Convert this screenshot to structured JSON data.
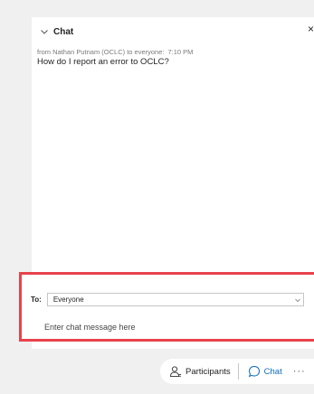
{
  "chat_panel": {
    "title": "Chat",
    "close_symbol": "×"
  },
  "message": {
    "sender_line": "from Nathan Putnam (OCLC) to everyone:",
    "time": "7:10 PM",
    "text": "How do I report an error to OCLC?"
  },
  "compose": {
    "to_label": "To:",
    "recipient": "Everyone",
    "placeholder": "Enter chat message here"
  },
  "toolbar": {
    "participants_label": "Participants",
    "chat_label": "Chat",
    "more_label": "···"
  },
  "colors": {
    "highlight_border": "#e8424c",
    "chat_accent": "#0f6cbd",
    "panel_bg": "#ffffff",
    "app_bg": "#f0f0f0"
  },
  "icons": [
    "chevron-down-icon",
    "close-icon",
    "dropdown-arrow-icon",
    "participants-icon",
    "chat-bubble-icon",
    "more-icon"
  ]
}
